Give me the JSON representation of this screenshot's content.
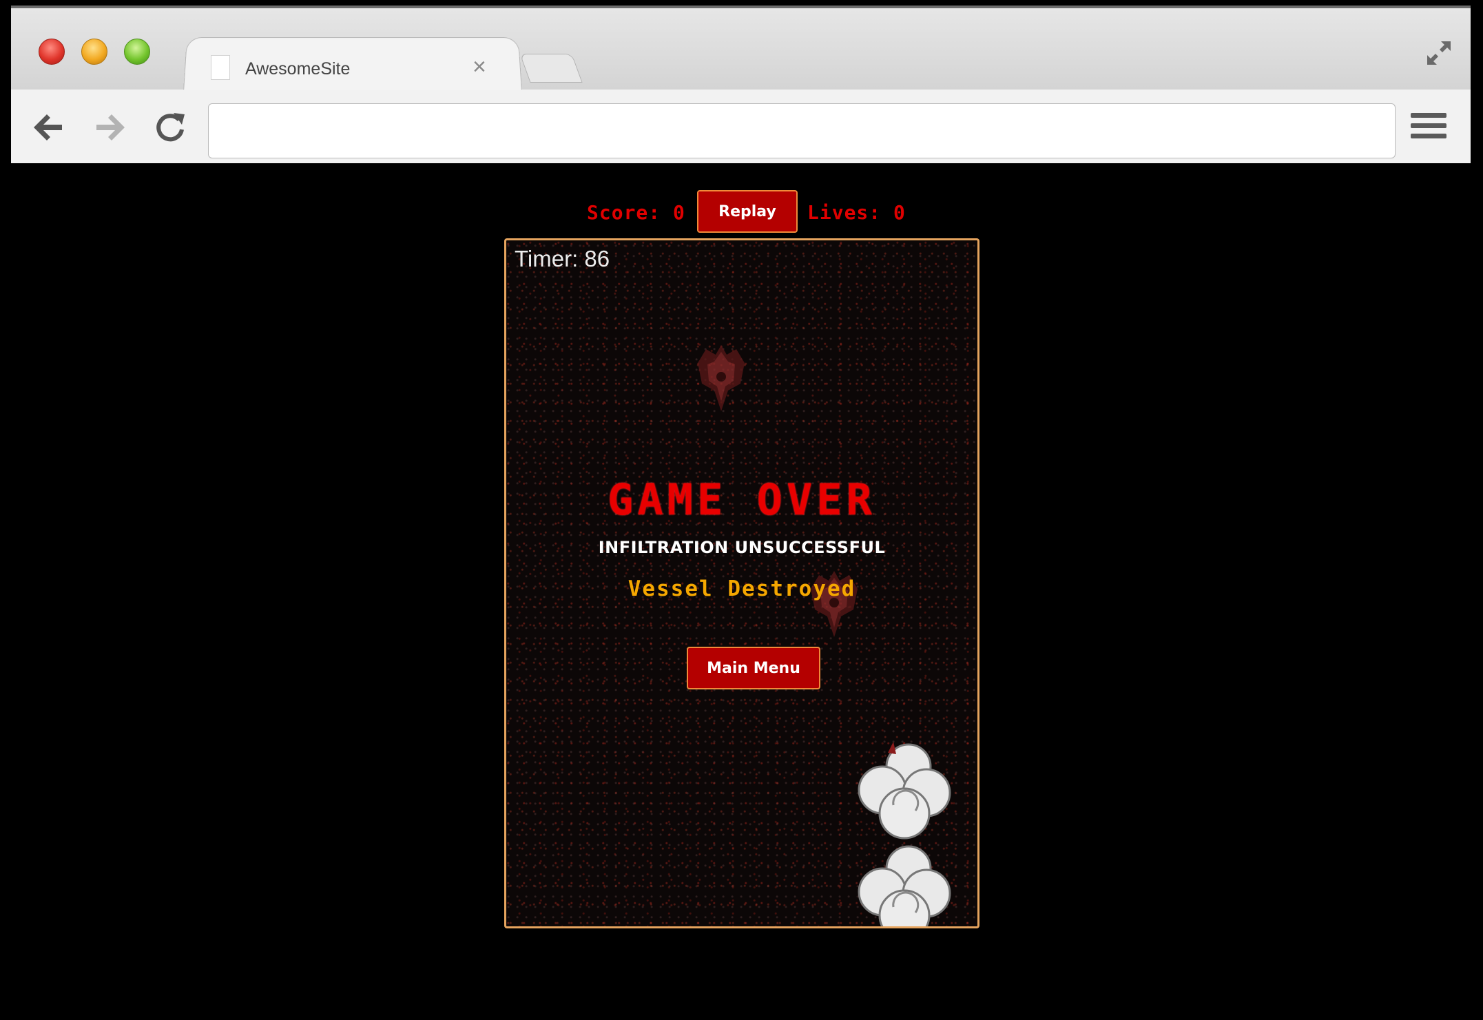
{
  "browser": {
    "tab_title": "AwesomeSite",
    "tab_close_glyph": "×",
    "address_value": "",
    "icons": {
      "back": "back-arrow-icon",
      "forward": "forward-arrow-icon",
      "reload": "reload-icon",
      "menu": "hamburger-menu-icon",
      "fullscreen": "fullscreen-icon"
    }
  },
  "hud": {
    "score_text": "Score: 0",
    "replay_label": "Replay",
    "lives_text": "Lives: 0"
  },
  "game": {
    "timer_text": "Timer: 86",
    "title": "GAME OVER",
    "subtitle": "INFILTRATION UNSUCCESSFUL",
    "reason": "Vessel Destroyed",
    "main_menu_label": "Main Menu"
  },
  "colors": {
    "accent_red": "#e00000",
    "button_red": "#b40000",
    "canvas_border": "#e6a45e",
    "reason_yellow": "#f5a700"
  }
}
